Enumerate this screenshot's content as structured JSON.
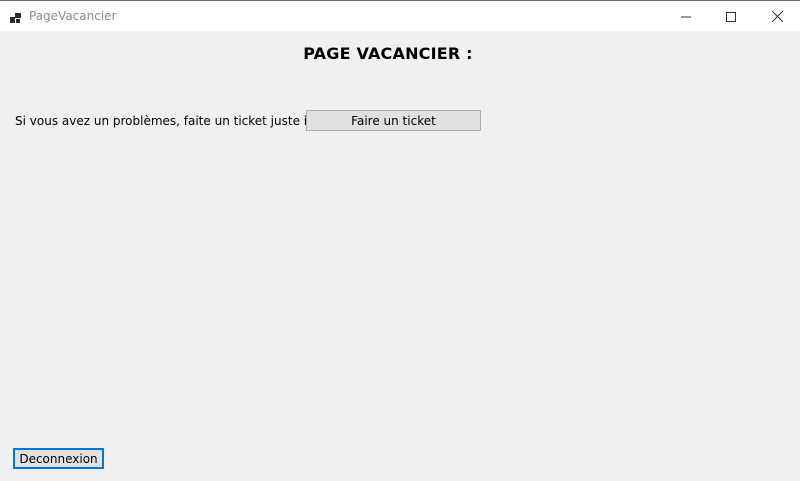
{
  "window": {
    "title": "PageVacancier",
    "icon": "app-form-icon",
    "controls": [
      "minimize-icon",
      "maximize-icon",
      "close-icon"
    ]
  },
  "main": {
    "heading": "PAGE VACANCIER :",
    "help_text": "Si vous avez un problèmes, faite un ticket juste ici :",
    "ticket_button_label": "Faire un ticket"
  },
  "footer": {
    "logout_button_label": "Deconnexion"
  },
  "colors": {
    "background": "#f0f0f0",
    "button": "#e1e1e1",
    "focus_border": "#0078d7"
  }
}
